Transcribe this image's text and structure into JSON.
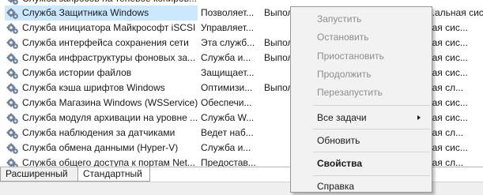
{
  "services": [
    {
      "name": "Служба запросов на теневое копиров...",
      "desc": "",
      "status": "",
      "start": "",
      "partial": true
    },
    {
      "name": "Служба Защитника Windows",
      "desc": "Позволяет...",
      "status": "Выпол",
      "start": "...альная сис...",
      "selected": true
    },
    {
      "name": "Служба инициатора Майкрософт iSCSI",
      "desc": "Управляет...",
      "status": "",
      "start": "ная сис..."
    },
    {
      "name": "Служба интерфейса сохранения сети",
      "desc": "Эта служб...",
      "status": "Выпол",
      "start": "ная сис..."
    },
    {
      "name": "Служба инфраструктуры фоновых за...",
      "desc": "Служба и...",
      "status": "Выпол",
      "start": "ная сис..."
    },
    {
      "name": "Служба истории файлов",
      "desc": "Защищает...",
      "status": "",
      "start": "ная сис..."
    },
    {
      "name": "Служба кэша шрифтов Windows",
      "desc": "Оптимизи...",
      "status": "Выпол",
      "start": "ная сл..."
    },
    {
      "name": "Служба Магазина Windows (WSService)",
      "desc": "Обеспечи...",
      "status": "",
      "start": "ная сис..."
    },
    {
      "name": "Служба модуля архивации на уровне ...",
      "desc": "Служба W...",
      "status": "",
      "start": "ная сис..."
    },
    {
      "name": "Служба наблюдения за датчиками",
      "desc": "Ведет наб...",
      "status": "",
      "start": "ная сл..."
    },
    {
      "name": "Служба обмена данными (Hyper-V)",
      "desc": "Служба и...",
      "status": "",
      "start": "ная сис..."
    },
    {
      "name": "Служба общего доступа к портам Net...",
      "desc": "Предостав...",
      "status": "",
      "start": "ная сл...",
      "partial": true
    }
  ],
  "tabs": {
    "extended": "Расширенный",
    "standard": "Стандартный"
  },
  "context_menu": {
    "start": "Запустить",
    "stop": "Остановить",
    "pause": "Приостановить",
    "resume": "Продолжить",
    "restart": "Перезапустить",
    "all_tasks": "Все задачи",
    "refresh": "Обновить",
    "properties": "Свойства",
    "help": "Справка"
  },
  "colors": {
    "selection": "#cce8ff",
    "menu_bg": "#f2f2f2",
    "disabled_text": "#8d8d8d"
  },
  "icons": {
    "service": "gear-icon",
    "submenu": "submenu-arrow-icon"
  }
}
